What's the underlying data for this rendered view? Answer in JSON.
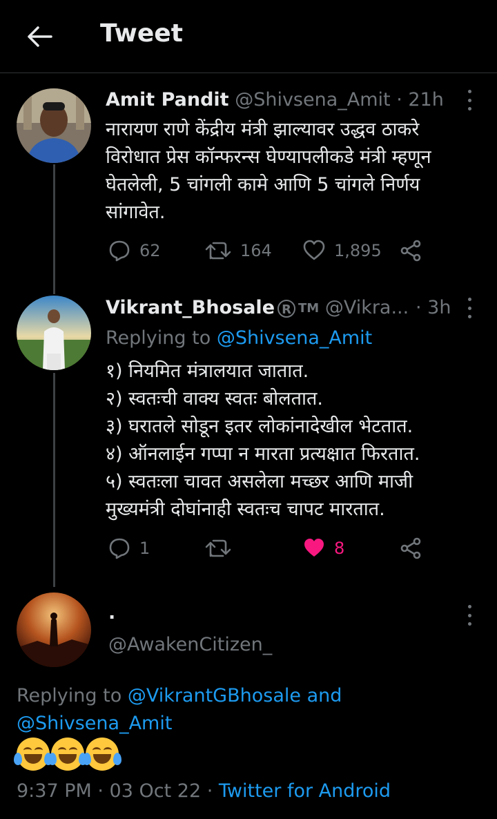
{
  "header": {
    "title": "Tweet"
  },
  "tweets": [
    {
      "name": "Amit Pandit",
      "handle": "@Shivsena_Amit",
      "time": "· 21h",
      "text": "नारायण राणे केंद्रीय मंत्री झाल्यावर उद्धव ठाकरे\nविरोधात प्रेस कॉन्फरन्स घेण्यापलीकडे मंत्री म्हणून\nघेतलेली, 5 चांगली कामे आणि 5 चांगले निर्णय\nसांगावेत.",
      "replies": "62",
      "retweets": "164",
      "likes": "1,895"
    },
    {
      "name": "Vikrant_Bhosale",
      "badge_r": "R",
      "badge_tm": "TM",
      "handle": "@Vikra...",
      "time": "· 3h",
      "replying_prefix": "Replying to",
      "replying_to": "@Shivsena_Amit",
      "text": "१) नियमित मंत्रालयात जातात.\n२) स्वतःची वाक्य स्वतः बोलतात.\n३) घरातले सोडून इतर लोकांनादेखील भेटतात.\n४) ऑनलाईन गप्पा न मारता प्रत्यक्षात फिरतात.\n५) स्वतःला चावत असलेला मच्छर आणि माजी\nमुख्यमंत्री दोघांनाही स्वतःच चापट मारतात.",
      "replies": "1",
      "likes": "8"
    },
    {
      "name": ".",
      "handle": "@AwakenCitizen_",
      "replying_prefix": "Replying to",
      "replying_to_1": "@VikrantGBhosale",
      "replying_and": "and",
      "replying_to_2": "@Shivsena_Amit",
      "emojis": [
        "face-with-tears-of-joy",
        "face-with-tears-of-joy",
        "face-with-tears-of-joy"
      ],
      "timestamp_time": "9:37 PM",
      "timestamp_date": "· 03 Oct 22 ·",
      "source": "Twitter for Android"
    }
  ],
  "colors": {
    "background": "#000000",
    "accent": "#1d9bf0",
    "like": "#f91880",
    "muted": "#71767b"
  }
}
